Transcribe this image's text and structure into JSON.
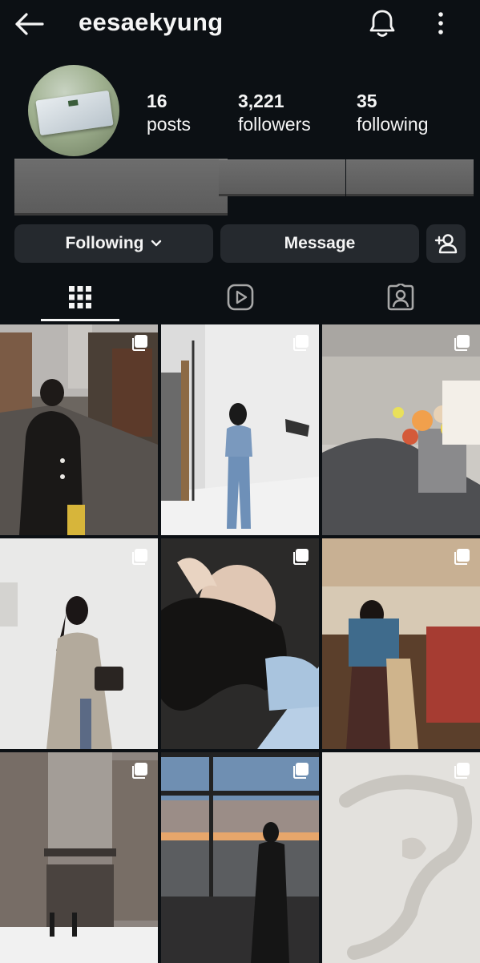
{
  "header": {
    "username": "eesaekyung"
  },
  "profile": {
    "stats": [
      {
        "value": "16",
        "label": "posts"
      },
      {
        "value": "3,221",
        "label": "followers"
      },
      {
        "value": "35",
        "label": "following"
      }
    ]
  },
  "actions": {
    "following_label": "Following",
    "message_label": "Message"
  },
  "tabs": [
    "grid",
    "reels",
    "tagged"
  ],
  "grid": {
    "posts": [
      {
        "icon": "carousel-icon"
      },
      {
        "icon": "carousel-icon"
      },
      {
        "icon": "carousel-icon"
      },
      {
        "icon": "carousel-icon"
      },
      {
        "icon": "carousel-icon"
      },
      {
        "icon": "carousel-icon"
      },
      {
        "icon": "carousel-icon"
      },
      {
        "icon": "carousel-icon"
      },
      {
        "icon": "carousel-icon"
      }
    ]
  },
  "colors": {
    "background": "#0c1014",
    "button": "#25292e",
    "text": "#f5f5f5"
  }
}
